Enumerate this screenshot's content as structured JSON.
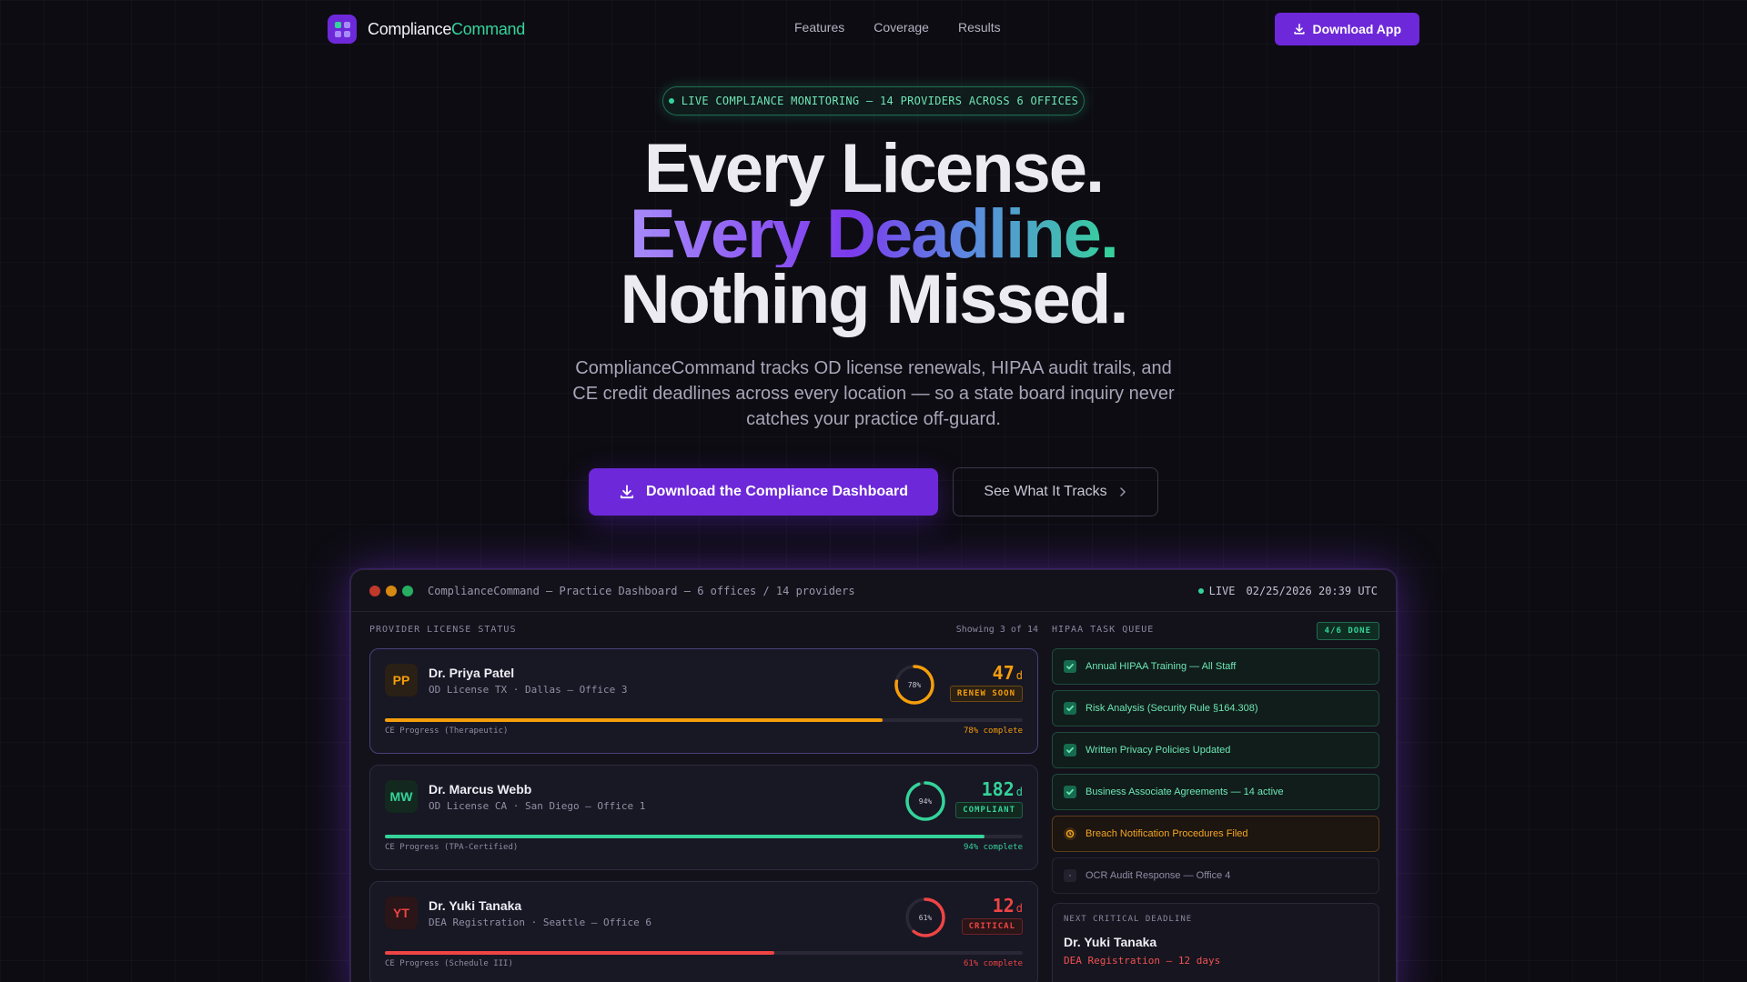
{
  "nav": {
    "brand_a": "Compliance",
    "brand_b": "Command",
    "links": [
      "Features",
      "Coverage",
      "Results"
    ],
    "download": "Download App"
  },
  "hero": {
    "pill": "LIVE COMPLIANCE MONITORING — 14 PROVIDERS ACROSS 6 OFFICES",
    "line1": "Every License.",
    "line2": "Every Deadline.",
    "line3": "Nothing Missed.",
    "subtitle": "ComplianceCommand tracks OD license renewals, HIPAA audit trails, and CE credit deadlines across every location — so a state board inquiry never catches your practice off-guard.",
    "cta_primary": "Download the Compliance Dashboard",
    "cta_secondary": "See What It Tracks"
  },
  "dashboard": {
    "title": "ComplianceCommand — Practice Dashboard — 6 offices / 14 providers",
    "live": "LIVE",
    "timestamp": "02/25/2026 20:39 UTC",
    "providers_heading": "PROVIDER LICENSE STATUS",
    "showing": "Showing 3 of 14",
    "providers": [
      {
        "initials": "PP",
        "name": "Dr. Priya Patel",
        "info": "OD License TX · Dallas — Office 3",
        "ring": "78%",
        "ring_value": 0.78,
        "days": "47",
        "unit": "d",
        "status": "RENEW SOON",
        "ce_label": "CE Progress (Therapeutic)",
        "ce_pct": "78% complete",
        "progress": 0.78,
        "color": "#f59e0b"
      },
      {
        "initials": "MW",
        "name": "Dr. Marcus Webb",
        "info": "OD License CA · San Diego — Office 1",
        "ring": "94%",
        "ring_value": 0.94,
        "days": "182",
        "unit": "d",
        "status": "COMPLIANT",
        "ce_label": "CE Progress (TPA-Certified)",
        "ce_pct": "94% complete",
        "progress": 0.94,
        "color": "#34d399"
      },
      {
        "initials": "YT",
        "name": "Dr. Yuki Tanaka",
        "info": "DEA Registration · Seattle — Office 6",
        "ring": "61%",
        "ring_value": 0.61,
        "days": "12",
        "unit": "d",
        "status": "CRITICAL",
        "ce_label": "CE Progress (Schedule III)",
        "ce_pct": "61% complete",
        "progress": 0.61,
        "color": "#ef4444"
      }
    ],
    "hipaa_heading": "HIPAA TASK QUEUE",
    "hipaa_done": "4/6 DONE",
    "tasks": [
      {
        "label": "Annual HIPAA Training — All Staff",
        "state": "done"
      },
      {
        "label": "Risk Analysis (Security Rule §164.308)",
        "state": "done"
      },
      {
        "label": "Written Privacy Policies Updated",
        "state": "done"
      },
      {
        "label": "Business Associate Agreements — 14 active",
        "state": "done"
      },
      {
        "label": "Breach Notification Procedures Filed",
        "state": "warn"
      },
      {
        "label": "OCR Audit Response — Office 4",
        "state": "pending"
      }
    ],
    "next": {
      "label": "NEXT CRITICAL DEADLINE",
      "name": "Dr. Yuki Tanaka",
      "detail": "DEA Registration — 12 days"
    }
  },
  "colors": {
    "accent": "#6d28d9",
    "green": "#34d399",
    "amber": "#f59e0b",
    "red": "#ef4444"
  }
}
